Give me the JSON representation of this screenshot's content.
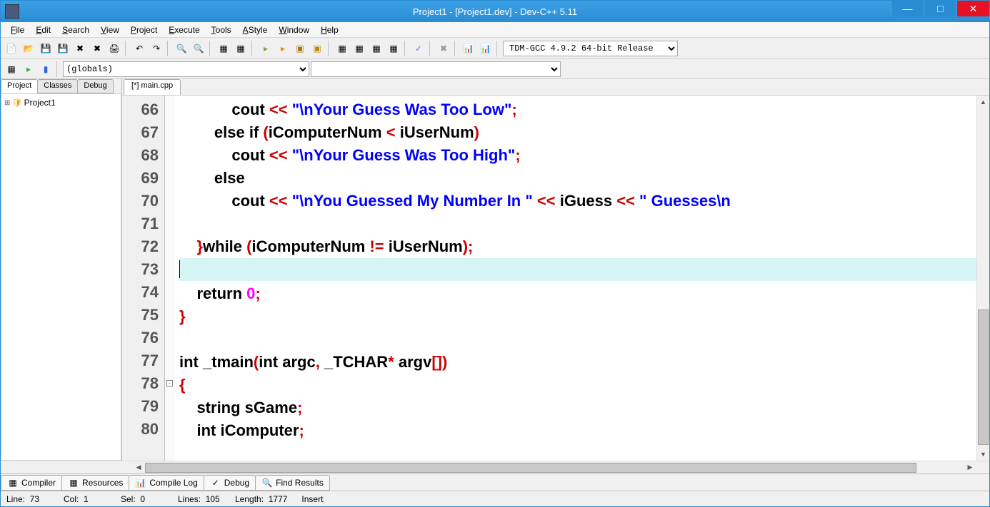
{
  "title": "Project1 - [Project1.dev] - Dev-C++ 5.11",
  "menu": [
    "File",
    "Edit",
    "Search",
    "View",
    "Project",
    "Execute",
    "Tools",
    "AStyle",
    "Window",
    "Help"
  ],
  "compiler_select": "TDM-GCC 4.9.2 64-bit Release",
  "scope_select": "(globals)",
  "sidetabs": [
    "Project",
    "Classes",
    "Debug"
  ],
  "project_name": "Project1",
  "editor_tab": "[*] main.cpp",
  "lines": [
    {
      "n": 66,
      "tokens": [
        {
          "t": "            cout ",
          "c": ""
        },
        {
          "t": "<<",
          "c": "punc"
        },
        {
          "t": " ",
          "c": ""
        },
        {
          "t": "\"\\nYour Guess Was Too Low\"",
          "c": "str"
        },
        {
          "t": ";",
          "c": "punc"
        }
      ]
    },
    {
      "n": 67,
      "tokens": [
        {
          "t": "        ",
          "c": ""
        },
        {
          "t": "else if",
          "c": "kw"
        },
        {
          "t": " ",
          "c": ""
        },
        {
          "t": "(",
          "c": "punc"
        },
        {
          "t": "iComputerNum ",
          "c": ""
        },
        {
          "t": "<",
          "c": "punc"
        },
        {
          "t": " iUserNum",
          "c": ""
        },
        {
          "t": ")",
          "c": "punc"
        }
      ]
    },
    {
      "n": 68,
      "tokens": [
        {
          "t": "            cout ",
          "c": ""
        },
        {
          "t": "<<",
          "c": "punc"
        },
        {
          "t": " ",
          "c": ""
        },
        {
          "t": "\"\\nYour Guess Was Too High\"",
          "c": "str"
        },
        {
          "t": ";",
          "c": "punc"
        }
      ]
    },
    {
      "n": 69,
      "tokens": [
        {
          "t": "        ",
          "c": ""
        },
        {
          "t": "else",
          "c": "kw"
        }
      ]
    },
    {
      "n": 70,
      "tokens": [
        {
          "t": "            cout ",
          "c": ""
        },
        {
          "t": "<<",
          "c": "punc"
        },
        {
          "t": " ",
          "c": ""
        },
        {
          "t": "\"\\nYou Guessed My Number In \"",
          "c": "str"
        },
        {
          "t": " ",
          "c": ""
        },
        {
          "t": "<<",
          "c": "punc"
        },
        {
          "t": " iGuess ",
          "c": ""
        },
        {
          "t": "<<",
          "c": "punc"
        },
        {
          "t": " ",
          "c": ""
        },
        {
          "t": "\" Guesses\\n",
          "c": "str"
        }
      ]
    },
    {
      "n": 71,
      "tokens": []
    },
    {
      "n": 72,
      "tokens": [
        {
          "t": "    ",
          "c": ""
        },
        {
          "t": "}",
          "c": "punc"
        },
        {
          "t": "while",
          "c": "kw"
        },
        {
          "t": " ",
          "c": ""
        },
        {
          "t": "(",
          "c": "punc"
        },
        {
          "t": "iComputerNum ",
          "c": ""
        },
        {
          "t": "!=",
          "c": "punc"
        },
        {
          "t": " iUserNum",
          "c": ""
        },
        {
          "t": ")",
          "c": "punc"
        },
        {
          "t": ";",
          "c": "punc"
        }
      ]
    },
    {
      "n": 73,
      "hl": true,
      "tokens": [
        {
          "t": "",
          "c": "cursor"
        }
      ]
    },
    {
      "n": 74,
      "tokens": [
        {
          "t": "    ",
          "c": ""
        },
        {
          "t": "return",
          "c": "kw"
        },
        {
          "t": " ",
          "c": ""
        },
        {
          "t": "0",
          "c": "num"
        },
        {
          "t": ";",
          "c": "punc"
        }
      ]
    },
    {
      "n": 75,
      "tokens": [
        {
          "t": "}",
          "c": "punc"
        }
      ]
    },
    {
      "n": 76,
      "tokens": []
    },
    {
      "n": 77,
      "tokens": [
        {
          "t": "int",
          "c": "kw"
        },
        {
          "t": " _tmain",
          "c": ""
        },
        {
          "t": "(",
          "c": "punc"
        },
        {
          "t": "int",
          "c": "kw"
        },
        {
          "t": " argc",
          "c": ""
        },
        {
          "t": ",",
          "c": "punc"
        },
        {
          "t": " _TCHAR",
          "c": ""
        },
        {
          "t": "*",
          "c": "punc"
        },
        {
          "t": " argv",
          "c": ""
        },
        {
          "t": "[])",
          "c": "punc"
        }
      ]
    },
    {
      "n": 78,
      "fold": true,
      "tokens": [
        {
          "t": "{",
          "c": "punc"
        }
      ]
    },
    {
      "n": 79,
      "tokens": [
        {
          "t": "    string sGame",
          "c": ""
        },
        {
          "t": ";",
          "c": "punc"
        }
      ]
    },
    {
      "n": 80,
      "tokens": [
        {
          "t": "    ",
          "c": ""
        },
        {
          "t": "int",
          "c": "kw"
        },
        {
          "t": " iComputer",
          "c": ""
        },
        {
          "t": ";",
          "c": "punc"
        }
      ]
    }
  ],
  "btabs": [
    "Compiler",
    "Resources",
    "Compile Log",
    "Debug",
    "Find Results"
  ],
  "status": {
    "line": "73",
    "col": "1",
    "sel": "0",
    "lines": "105",
    "length": "1777",
    "mode": "Insert"
  }
}
